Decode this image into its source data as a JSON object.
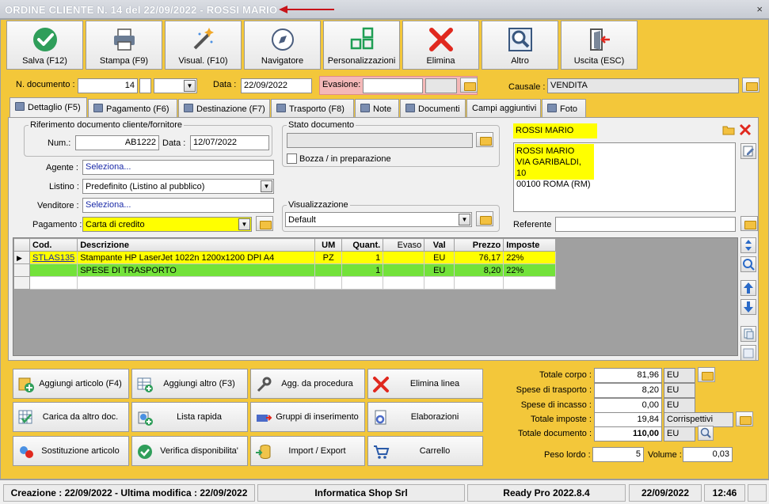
{
  "window": {
    "title": "ORDINE CLIENTE N. 14 del 22/09/2022 - ROSSI MARIO",
    "close_glyph": "×"
  },
  "toolbar": [
    {
      "label": "Salva (F12)",
      "icon": "check-icon"
    },
    {
      "label": "Stampa (F9)",
      "icon": "printer-icon"
    },
    {
      "label": "Visual. (F10)",
      "icon": "wand-icon"
    },
    {
      "label": "Navigatore",
      "icon": "compass-icon"
    },
    {
      "label": "Personalizzazioni",
      "icon": "grid-icon"
    },
    {
      "label": "Elimina",
      "icon": "delete-x-icon"
    },
    {
      "label": "Altro",
      "icon": "magnifier-icon"
    },
    {
      "label": "Uscita (ESC)",
      "icon": "exit-door-icon"
    }
  ],
  "header": {
    "ndoc_label": "N. documento :",
    "ndoc_value": "14",
    "data_label": "Data :",
    "data_value": "22/09/2022",
    "evasione_label": "Evasione:",
    "causale_label": "Causale :",
    "causale_value": "VENDITA"
  },
  "tabs": [
    {
      "label": "Dettaglio (F5)",
      "active": true
    },
    {
      "label": "Pagamento (F6)"
    },
    {
      "label": "Destinazione (F7)"
    },
    {
      "label": "Trasporto (F8)"
    },
    {
      "label": "Note"
    },
    {
      "label": "Documenti"
    },
    {
      "label": "Campi aggiuntivi"
    },
    {
      "label": "Foto"
    }
  ],
  "riferimento": {
    "title": "Riferimento documento cliente/fornitore",
    "num_label": "Num.:",
    "num_value": "AB1222",
    "data_label": "Data :",
    "data_value": "12/07/2022"
  },
  "stato": {
    "title": "Stato documento",
    "value": "",
    "bozza_label": "Bozza / in preparazione",
    "bozza_checked": false
  },
  "visualizzazione": {
    "title": "Visualizzazione",
    "value": "Default"
  },
  "fields": {
    "agente_label": "Agente :",
    "agente_value": "Seleziona...",
    "listino_label": "Listino :",
    "listino_value": "Predefinito (Listino al pubblico)",
    "venditore_label": "Venditore :",
    "venditore_value": "Seleziona...",
    "pagamento_label": "Pagamento :",
    "pagamento_value": "Carta di credito"
  },
  "cliente": {
    "name": "ROSSI MARIO",
    "address_lines": [
      "ROSSI MARIO",
      "VIA GARIBALDI, 10",
      "00100 ROMA (RM)"
    ],
    "referente_label": "Referente",
    "referente_value": ""
  },
  "grid": {
    "columns": [
      "Cod.",
      "Descrizione",
      "UM",
      "Quant.",
      "Evaso",
      "Val",
      "Prezzo",
      "Imposte"
    ],
    "rows": [
      {
        "cod": "STLAS135",
        "descrizione": "Stampante HP LaserJet 1022n 1200x1200 DPI A4",
        "um": "PZ",
        "quant": "1",
        "evaso": "",
        "val": "EU",
        "prezzo": "76,17",
        "imposte": "22%"
      },
      {
        "cod": "",
        "descrizione": "SPESE DI TRASPORTO",
        "um": "",
        "quant": "1",
        "evaso": "",
        "val": "EU",
        "prezzo": "8,20",
        "imposte": "22%"
      },
      {
        "cod": "",
        "descrizione": "",
        "um": "",
        "quant": "",
        "evaso": "",
        "val": "",
        "prezzo": "",
        "imposte": ""
      }
    ]
  },
  "actions": [
    {
      "label": "Aggiungi articolo (F4)",
      "icon": "add-article-icon"
    },
    {
      "label": "Aggiungi altro (F3)",
      "icon": "add-other-icon"
    },
    {
      "label": "Agg. da procedura",
      "icon": "wrench-icon"
    },
    {
      "label": "Elimina linea",
      "icon": "delete-line-icon"
    },
    {
      "label": "Carica da altro doc.",
      "icon": "load-doc-icon"
    },
    {
      "label": "Lista rapida",
      "icon": "quick-list-icon"
    },
    {
      "label": "Gruppi di inserimento",
      "icon": "groups-icon"
    },
    {
      "label": "Elaborazioni",
      "icon": "processing-icon"
    },
    {
      "label": "Sostituzione articolo",
      "icon": "replace-icon"
    },
    {
      "label": "Verifica disponibilita'",
      "icon": "verify-icon"
    },
    {
      "label": "Import / Export",
      "icon": "import-export-icon"
    },
    {
      "label": "Carrello",
      "icon": "cart-icon"
    }
  ],
  "totals": {
    "corpo_label": "Totale corpo :",
    "corpo_value": "81,96",
    "corpo_cur": "EU",
    "trasporto_label": "Spese di trasporto :",
    "trasporto_value": "8,20",
    "trasporto_cur": "EU",
    "incasso_label": "Spese di incasso :",
    "incasso_value": "0,00",
    "incasso_cur": "EU",
    "imposte_label": "Totale imposte :",
    "imposte_value": "19,84",
    "imposte_extra": "Corrispettivi",
    "documento_label": "Totale documento :",
    "documento_value": "110,00",
    "documento_cur": "EU",
    "peso_label": "Peso lordo :",
    "peso_value": "5",
    "volume_label": "Volume :",
    "volume_value": "0,03"
  },
  "status": {
    "dates": "Creazione : 22/09/2022 - Ultima modifica : 22/09/2022",
    "company": "Informatica Shop Srl",
    "version": "Ready Pro 2022.8.4",
    "date": "22/09/2022",
    "time": "12:46"
  },
  "colors": {
    "background": "#f3c73a",
    "highlight_yellow": "#ffff00",
    "row_green": "#73e23a",
    "delete_red": "#e0281e"
  }
}
